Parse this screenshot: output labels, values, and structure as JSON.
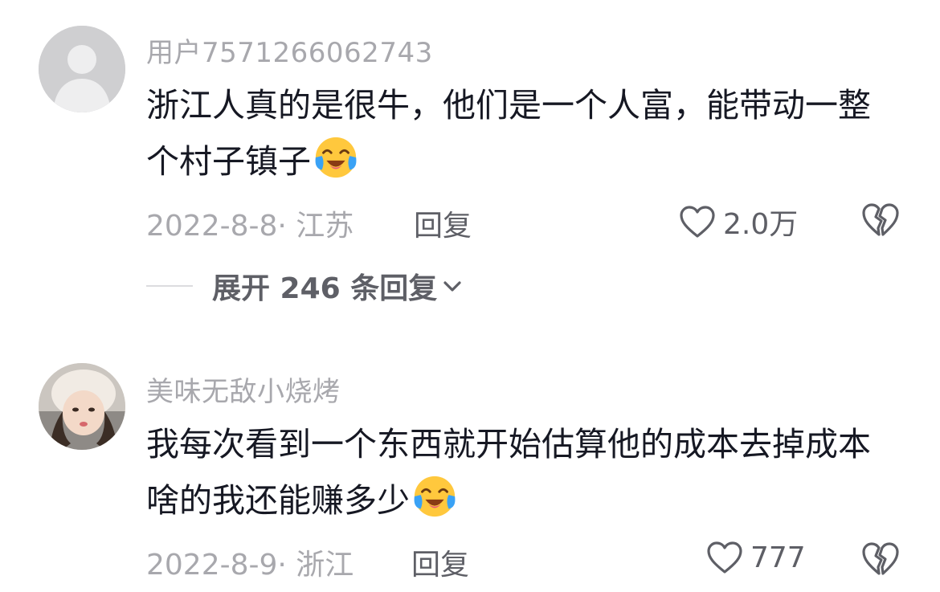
{
  "comments": [
    {
      "username": "用户7571266062743",
      "text": "浙江人真的是很牛，他们是一个人富，能带动一整个村子镇子",
      "emoji": "crying-laughing-emoji",
      "date_location": "2022-8-8· 江苏",
      "reply_label": "回复",
      "likes": "2.0万",
      "expand_label": "展开 246 条回复"
    },
    {
      "username": "美味无敌小烧烤",
      "text": "我每次看到一个东西就开始估算他的成本去掉成本啥的我还能赚多少",
      "emoji": "crying-laughing-emoji",
      "date_location": "2022-8-9· 浙江",
      "reply_label": "回复",
      "likes": "777"
    }
  ],
  "colors": {
    "text_primary": "#161823",
    "text_secondary": "#a8a8ad",
    "text_action": "#5e5f66",
    "emoji_yellow": "#ffc83d",
    "tears_blue": "#3aa2f5"
  },
  "icons": [
    "heart-outline-icon",
    "broken-heart-icon",
    "chevron-down-icon",
    "default-avatar-icon"
  ]
}
